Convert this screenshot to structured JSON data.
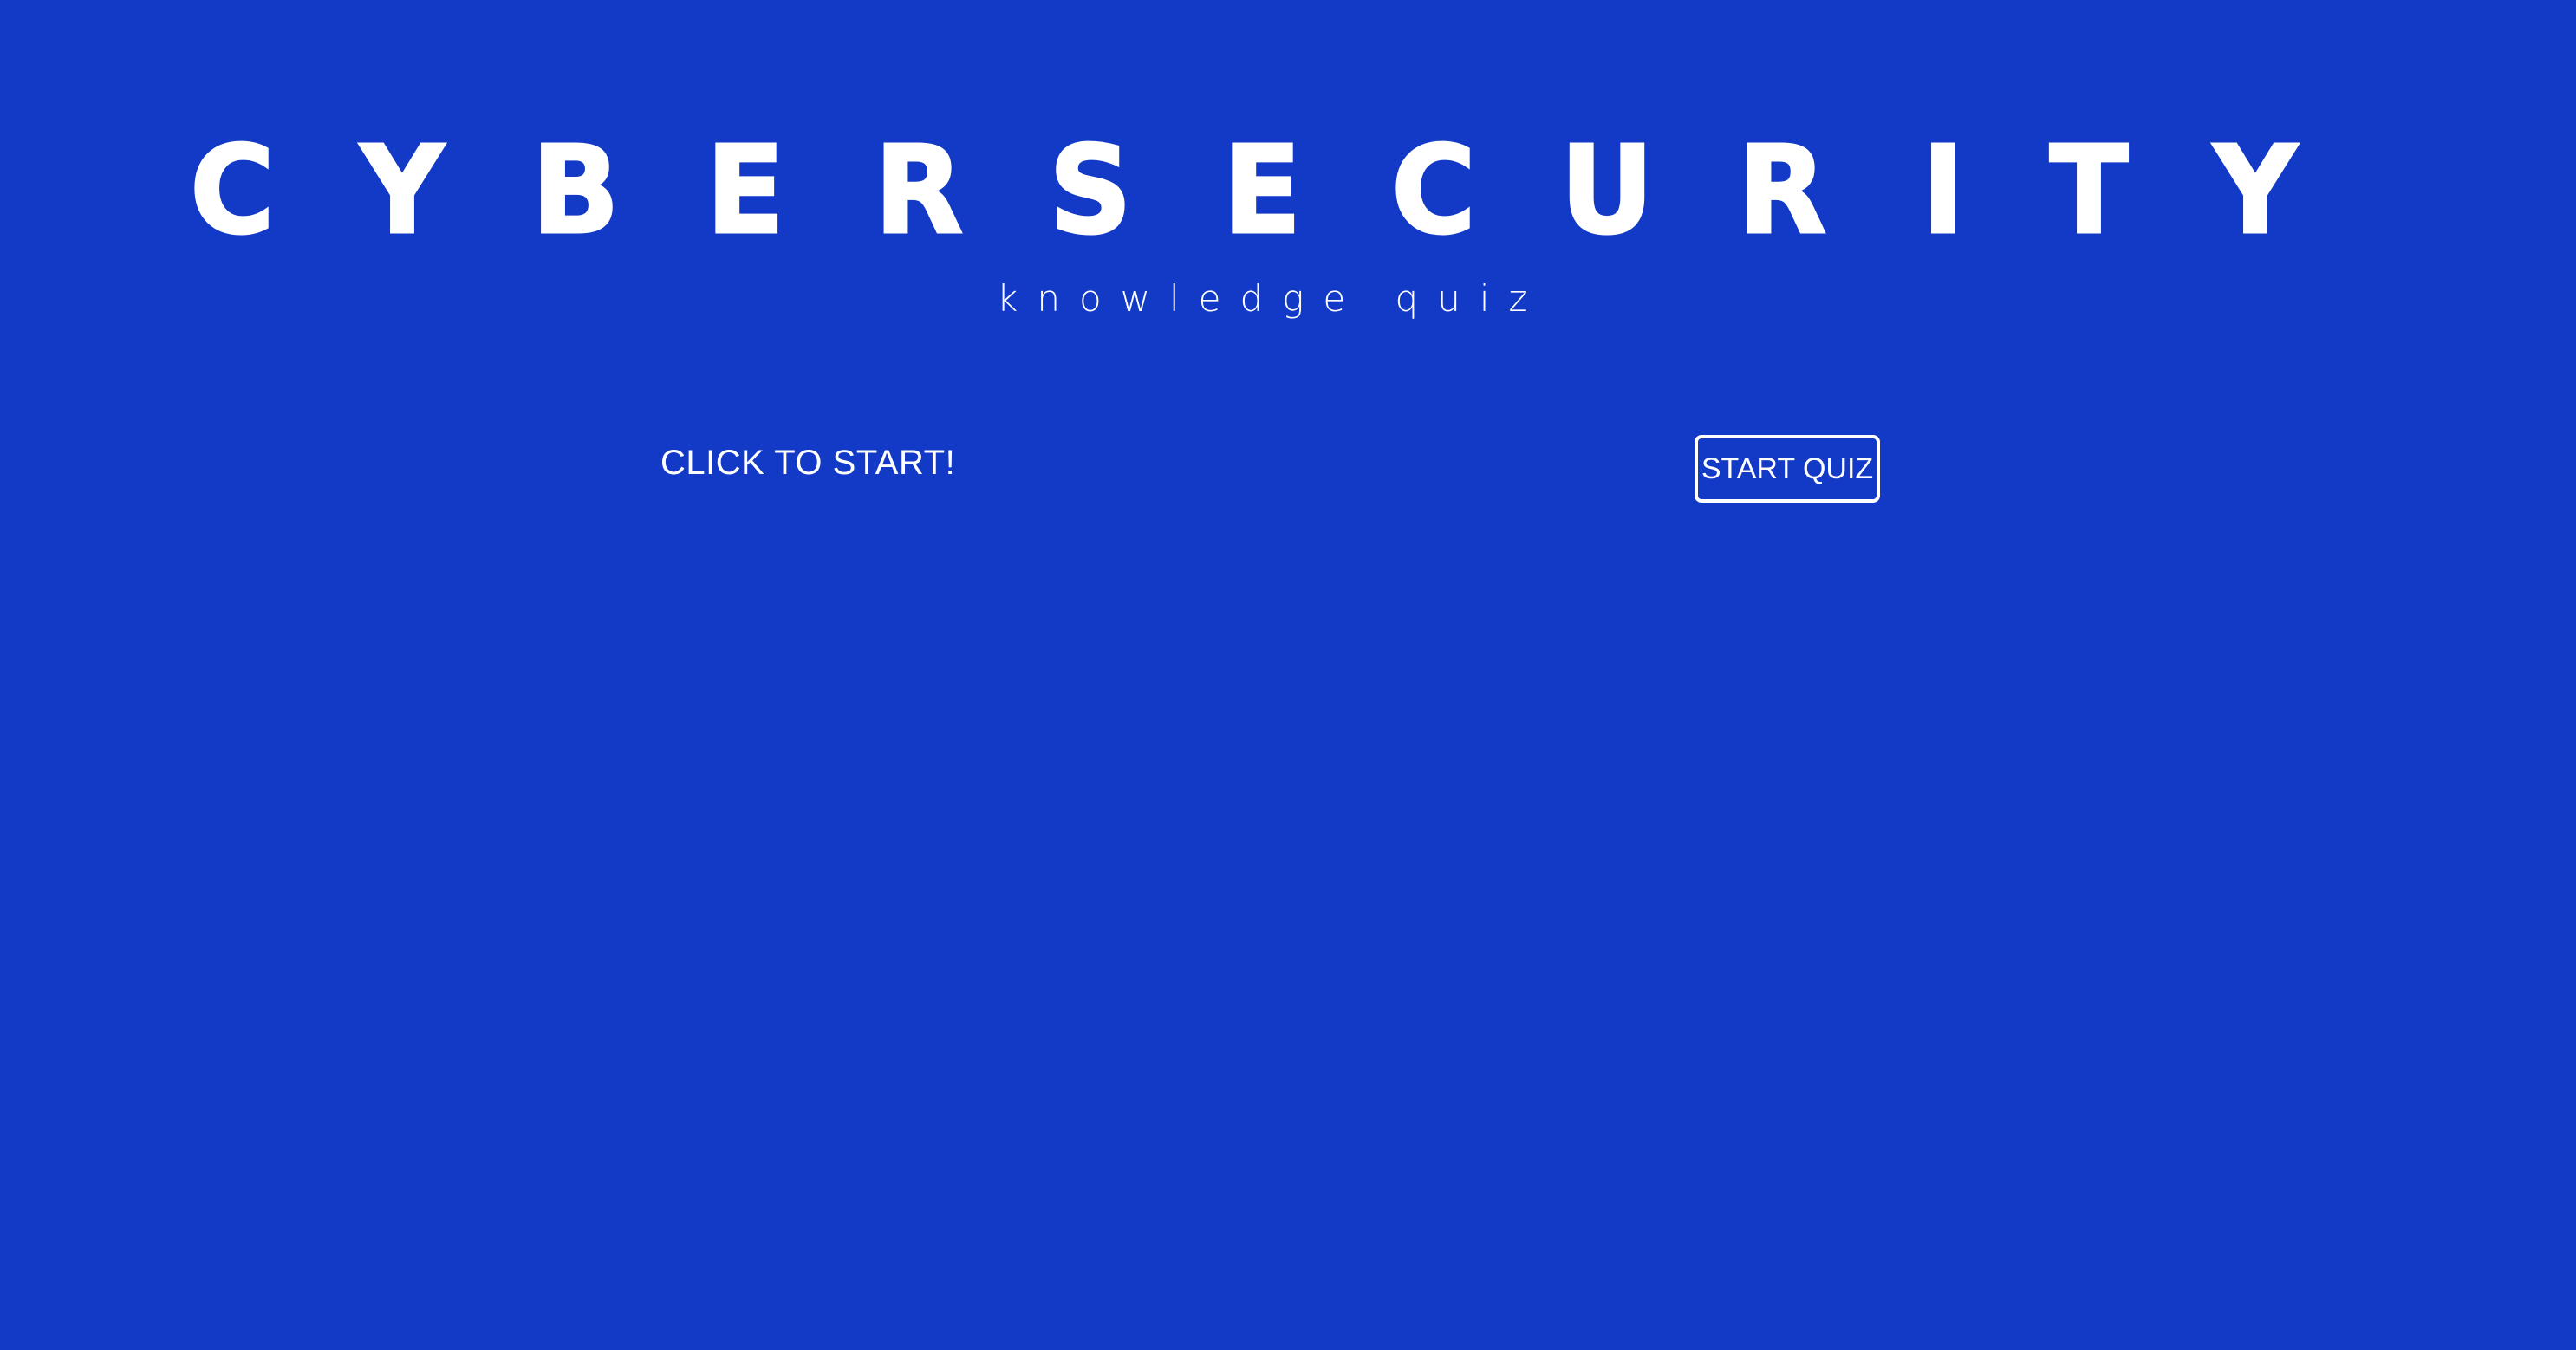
{
  "header": {
    "title_letters": [
      "C",
      "Y",
      "B",
      "E",
      "R",
      "S",
      "E",
      "C",
      "U",
      "R",
      "I",
      "T",
      "Y"
    ],
    "subtitle": "knowledge quiz"
  },
  "start": {
    "prompt": "CLICK TO START!",
    "button_label": "START QUIZ"
  },
  "colors": {
    "background": "#1339c7",
    "text": "#ffffff"
  }
}
